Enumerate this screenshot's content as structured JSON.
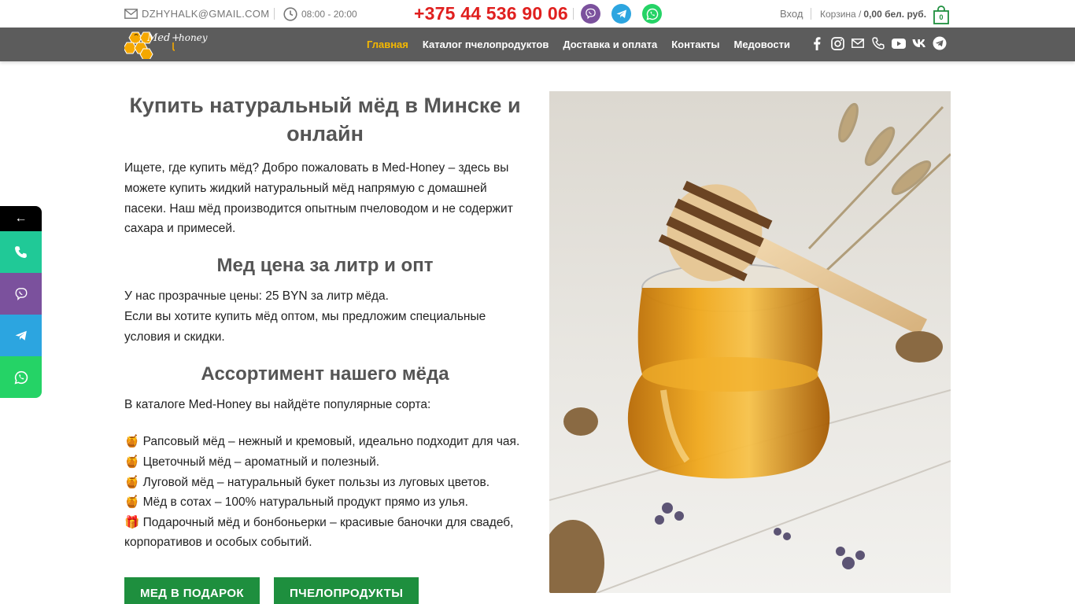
{
  "topbar": {
    "email": "DZHYHALK@GMAIL.COM",
    "hours": "08:00 - 20:00",
    "phone": "+375 44 536 90 06",
    "login": "Вход",
    "cart_label": "Корзина /",
    "cart_total": "0,00 бел. руб.",
    "cart_count": "0"
  },
  "nav": {
    "logo_text": "Med+honey",
    "items": [
      {
        "label": "Главная",
        "active": true
      },
      {
        "label": "Каталог пчелопродуктов",
        "active": false
      },
      {
        "label": "Доставка и оплата",
        "active": false
      },
      {
        "label": "Контакты",
        "active": false
      },
      {
        "label": "Медовости",
        "active": false
      }
    ],
    "social_icons": [
      "facebook-icon",
      "instagram-icon",
      "email-icon",
      "phone-icon",
      "youtube-icon",
      "vk-icon",
      "telegram-icon"
    ]
  },
  "side": {
    "toggle": "←",
    "buttons": [
      "phone-icon",
      "viber-icon",
      "telegram-icon",
      "whatsapp-icon"
    ]
  },
  "content": {
    "title": "Купить натуральный мёд в Минске и онлайн",
    "intro": "Ищете, где купить мёд? Добро пожаловать в Med-Honey – здесь вы можете купить жидкий натуральный мёд напрямую с домашней пасеки. Наш мёд производится опытным пчеловодом и не содержит сахара и примесей.",
    "price_heading": "Мед цена за литр и опт",
    "price_line1": "У нас прозрачные цены: 25 BYN за литр мёда.",
    "price_line2": "Если вы хотите купить мёд оптом, мы предложим специальные условия и скидки.",
    "assortment_heading": "Ассортимент нашего мёда",
    "assortment_intro": "В каталоге Med-Honey вы найдёте популярные сорта:",
    "list": [
      "🍯 Рапсовый мёд – нежный и кремовый, идеально подходит для чая.",
      "🍯 Цветочный мёд – ароматный и полезный.",
      "🍯 Луговой мёд – натуральный букет пользы из луговых цветов.",
      "🍯 Мёд в сотах – 100% натуральный продукт прямо из улья.",
      "🎁 Подарочный мёд и бонбоньерки – красивые баночки для свадеб, корпоративов и особых событий."
    ],
    "buttons": [
      "МЕД В ПОДАРОК",
      "ПЧЕЛОПРОДУКТЫ"
    ]
  },
  "colors": {
    "accent": "#f5b800",
    "phone": "#e0201f",
    "nav_bg": "#5c5c5c",
    "cta": "#1e8f3e"
  }
}
